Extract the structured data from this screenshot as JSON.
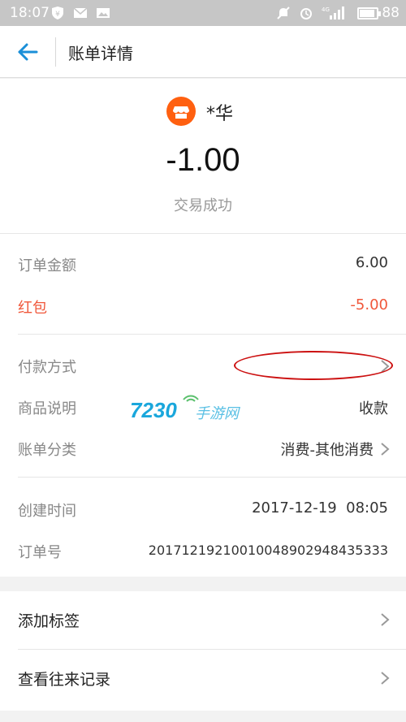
{
  "status_bar": {
    "time": "18:07",
    "battery": "88",
    "network": "4G"
  },
  "header": {
    "title": "账单详情"
  },
  "merchant": {
    "name": "*华",
    "amount": "-1.00",
    "status": "交易成功"
  },
  "details": {
    "order_amount_label": "订单金额",
    "order_amount_value": "6.00",
    "redpacket_label": "红包",
    "redpacket_value": "-5.00",
    "payment_method_label": "付款方式",
    "product_desc_label": "商品说明",
    "product_desc_value": "收款",
    "category_label": "账单分类",
    "category_value": "消费-其他消费",
    "created_time_label": "创建时间",
    "created_time_value": "2017-12-19  08:05",
    "order_no_label": "订单号",
    "order_no_value": "20171219210010048902948435333"
  },
  "watermark": {
    "number": "7230",
    "text": "手游网"
  },
  "actions": {
    "add_tag": "添加标签",
    "view_history": "查看往来记录"
  },
  "colors": {
    "accent": "#1a8fd8",
    "red": "#f0573a",
    "merchant_icon": "#ff6010",
    "status_bar": "#c6c6c6"
  },
  "icons": [
    "back-arrow-icon",
    "shop-icon",
    "chevron-right-icon"
  ]
}
